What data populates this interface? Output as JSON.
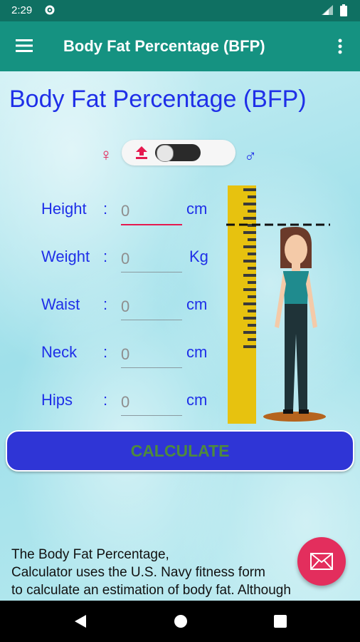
{
  "status_bar": {
    "time": "2:29"
  },
  "app_bar": {
    "title": "Body Fat Percentage (BFP)"
  },
  "heading": "Body Fat Percentage (BFP)",
  "gender": {
    "female_symbol": "♀",
    "male_symbol": "♂",
    "selected": "female"
  },
  "fields": [
    {
      "label": "Height",
      "colon": ":",
      "placeholder": "0",
      "unit": "cm"
    },
    {
      "label": "Weight",
      "colon": ":",
      "placeholder": "0",
      "unit": "Kg"
    },
    {
      "label": "Waist",
      "colon": ":",
      "placeholder": "0",
      "unit": "cm"
    },
    {
      "label": "Neck",
      "colon": ":",
      "placeholder": "0",
      "unit": "cm"
    },
    {
      "label": "Hips",
      "colon": ":",
      "placeholder": "0",
      "unit": "cm"
    }
  ],
  "calculate_label": "CALCULATE",
  "info_text": "The Body Fat Percentage,\n Calculator uses the U.S. Navy fitness form\nto calculate an estimation of body fat. Although",
  "colors": {
    "accent": "#1f2fe8",
    "app_bar": "#159281",
    "button": "#2f35d6",
    "fab": "#e32e5d"
  },
  "icons": [
    "gear-icon",
    "signal-icon",
    "battery-icon",
    "menu-icon",
    "more-vert-icon",
    "upload-icon",
    "mail-icon",
    "nav-back-icon",
    "nav-home-icon",
    "nav-recent-icon"
  ]
}
